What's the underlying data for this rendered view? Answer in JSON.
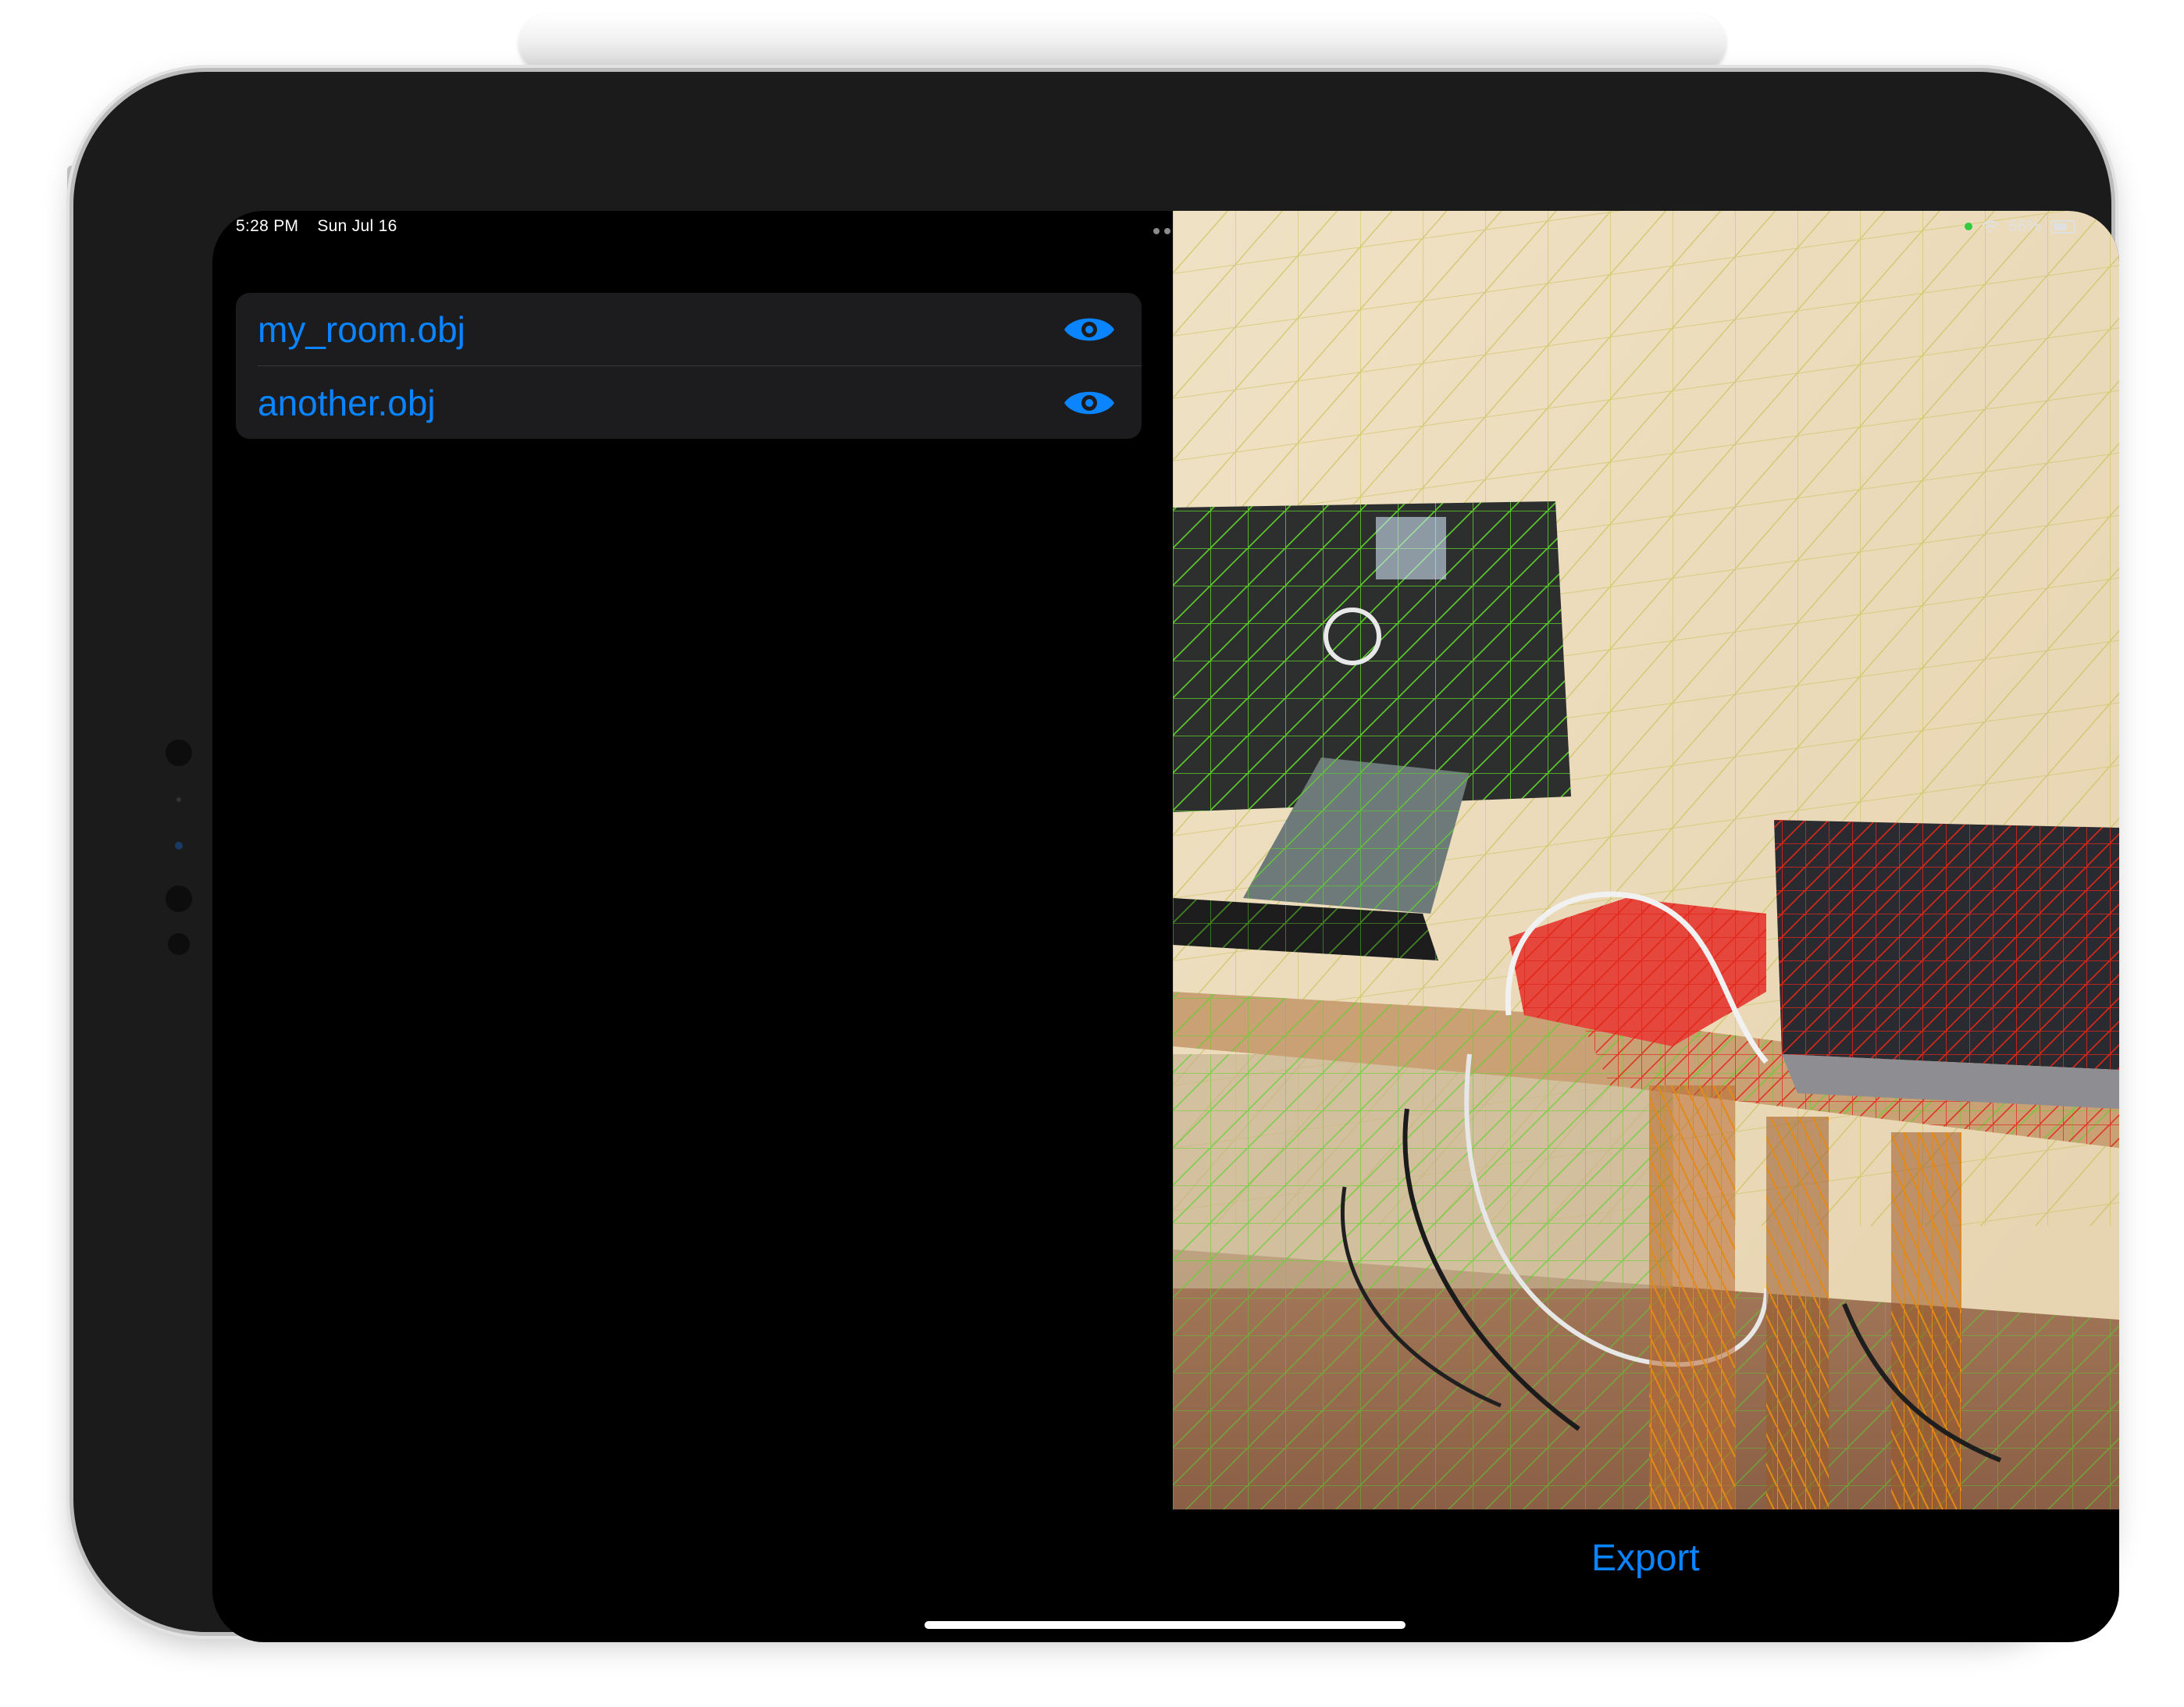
{
  "status_bar": {
    "time": "5:28 PM",
    "date": "Sun Jul 16",
    "battery": "66%"
  },
  "files": [
    {
      "name": "my_room.obj",
      "icon": "eye-icon"
    },
    {
      "name": "another.obj",
      "icon": "eye-icon"
    }
  ],
  "actions": {
    "export_label": "Export"
  },
  "colors": {
    "accent": "#0a84ff",
    "mesh_primary": "#5fd12a",
    "mesh_secondary": "#e3261a",
    "mesh_tertiary": "#e38a15"
  }
}
